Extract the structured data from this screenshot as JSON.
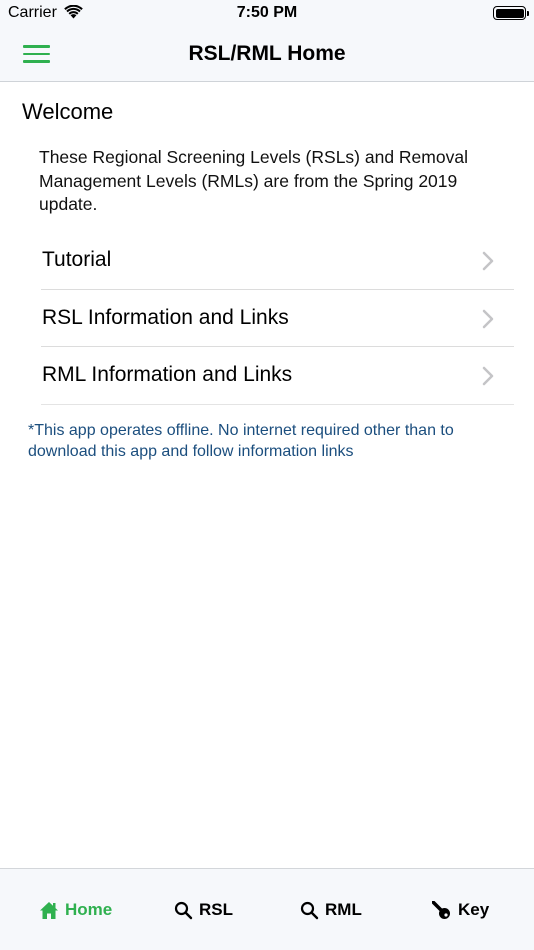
{
  "status_bar": {
    "carrier": "Carrier",
    "time": "7:50 PM"
  },
  "nav": {
    "title": "RSL/RML Home",
    "menu_icon": "hamburger-menu-icon"
  },
  "content": {
    "heading": "Welcome",
    "intro": "These Regional Screening Levels (RSLs) and Removal Management Levels (RMLs) are from the Spring 2019 update.",
    "items": [
      {
        "label": "Tutorial",
        "icon": "chevron-right-icon"
      },
      {
        "label": "RSL Information and Links",
        "icon": "chevron-right-icon"
      },
      {
        "label": "RML Information and Links",
        "icon": "chevron-right-icon"
      }
    ],
    "note": "*This app operates offline. No internet required other than to download this app and follow information links"
  },
  "tabbar": {
    "tabs": [
      {
        "label": "Home",
        "icon": "home-icon",
        "active": true
      },
      {
        "label": "RSL",
        "icon": "search-icon",
        "active": false
      },
      {
        "label": "RML",
        "icon": "search-icon",
        "active": false
      },
      {
        "label": "Key",
        "icon": "key-icon",
        "active": false
      }
    ]
  },
  "colors": {
    "accent": "#2fb04f",
    "note_text": "#1b4e7e",
    "bar_background": "#f6f8fb"
  }
}
